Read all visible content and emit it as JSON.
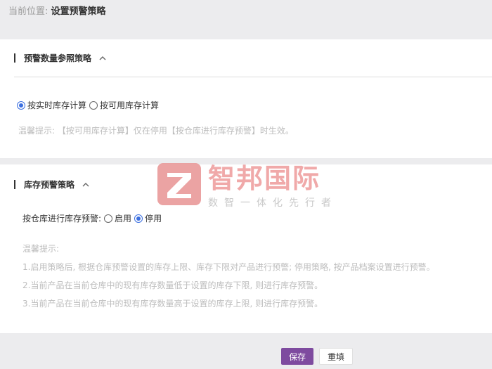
{
  "breadcrumb": {
    "label": "当前位置:",
    "current": "设置预警策略"
  },
  "section1": {
    "title": "预警数量参照策略",
    "options": [
      "按实时库存计算",
      "按可用库存计算"
    ],
    "selected_index": 0,
    "tip": "温馨提示: 【按可用库存计算】仅在停用【按仓库进行库存预警】时生效。"
  },
  "section2": {
    "title": "库存预警策略",
    "toggle_label": "按仓库进行库存预警:",
    "options": [
      "启用",
      "停用"
    ],
    "selected_index": 1,
    "tip_title": "温馨提示:",
    "tips": [
      "1.启用策略后, 根据仓库预警设置的库存上限、库存下限对产品进行预警; 停用策略, 按产品档案设置进行预警。",
      "2.当前产品在当前仓库中的现有库存数量低于设置的库存下限, 则进行库存预警。",
      "3.当前产品在当前仓库中的现有库存数量高于设置的库存上限, 则进行库存预警。"
    ]
  },
  "watermark": {
    "title": "智邦国际",
    "subtitle": "数智一体化先行者"
  },
  "actions": {
    "save": "保存",
    "reset": "重填"
  },
  "colors": {
    "primary": "#7e4b9f",
    "radio_active": "#3b6fe0",
    "tip_text": "#bdbdbd"
  }
}
